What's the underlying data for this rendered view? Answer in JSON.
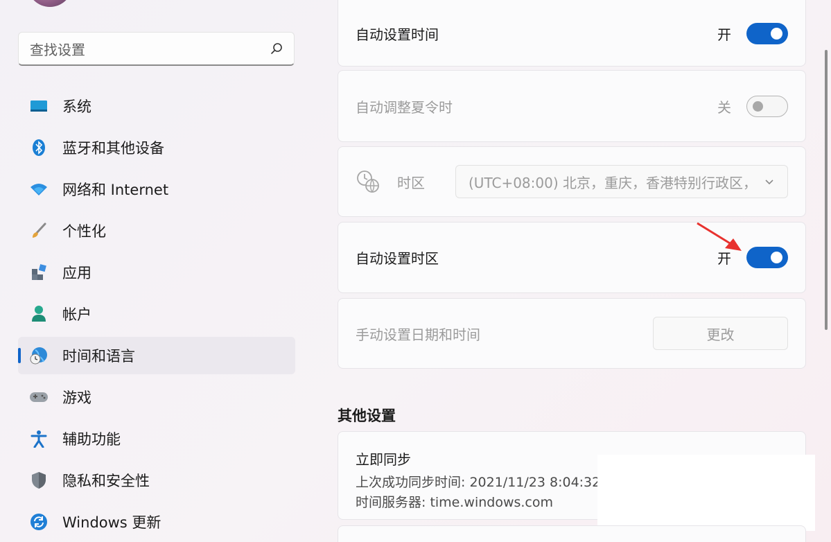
{
  "sidebar": {
    "search_placeholder": "查找设置",
    "items": [
      {
        "label": "系统",
        "icon": "display-icon"
      },
      {
        "label": "蓝牙和其他设备",
        "icon": "bluetooth-icon"
      },
      {
        "label": "网络和 Internet",
        "icon": "wifi-icon"
      },
      {
        "label": "个性化",
        "icon": "brush-icon"
      },
      {
        "label": "应用",
        "icon": "apps-icon"
      },
      {
        "label": "帐户",
        "icon": "account-icon"
      },
      {
        "label": "时间和语言",
        "icon": "time-language-icon",
        "active": true
      },
      {
        "label": "游戏",
        "icon": "gamepad-icon"
      },
      {
        "label": "辅助功能",
        "icon": "accessibility-icon"
      },
      {
        "label": "隐私和安全性",
        "icon": "shield-icon"
      },
      {
        "label": "Windows 更新",
        "icon": "update-icon"
      }
    ]
  },
  "main": {
    "auto_time": {
      "label": "自动设置时间",
      "state": "开"
    },
    "auto_dst": {
      "label": "自动调整夏令时",
      "state": "关"
    },
    "timezone": {
      "label": "时区",
      "value": "(UTC+08:00) 北京，重庆，香港特别行政区，"
    },
    "auto_timezone": {
      "label": "自动设置时区",
      "state": "开"
    },
    "manual": {
      "label": "手动设置日期和时间",
      "button": "更改"
    },
    "other_title": "其他设置",
    "sync": {
      "title": "立即同步",
      "last_sync": "上次成功同步时间: 2021/11/23 8:04:32",
      "server": "时间服务器: time.windows.com"
    }
  },
  "colors": {
    "accent": "#0f64c9",
    "arrow": "#e8322f"
  }
}
